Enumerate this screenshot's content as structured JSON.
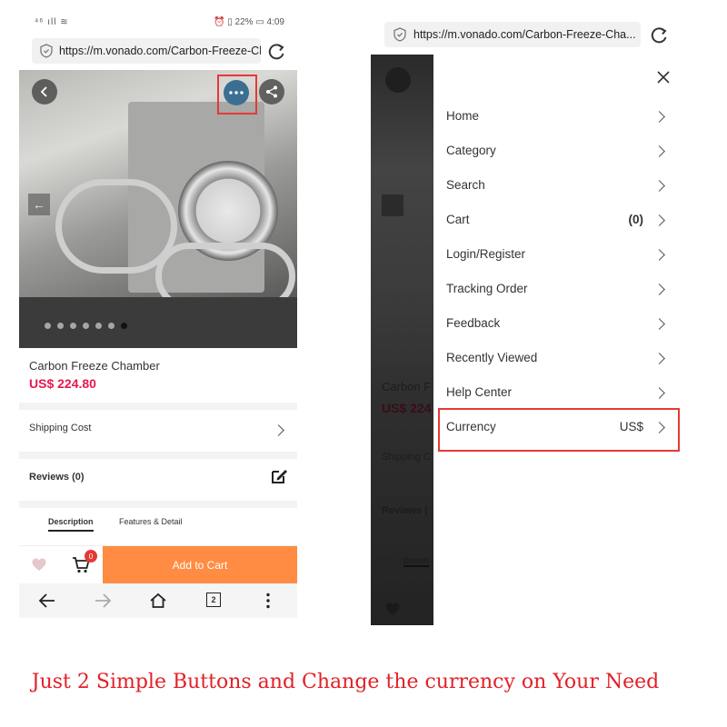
{
  "left_screen": {
    "status": {
      "left": "⁴⁶ ıll ≋",
      "right": "⏰ ▯ 22% ▭ 4:09"
    },
    "url": "https://m.vonado.com/Carbon-Freeze-Cha...",
    "product": {
      "title": "Carbon Freeze Chamber",
      "price": "US$ 224.80"
    },
    "rows": {
      "shipping": "Shipping Cost",
      "reviews": "Reviews (0)"
    },
    "tabs": [
      "Description",
      "Features & Detail"
    ],
    "cart": {
      "badge": "0",
      "add_to_cart": "Add to Cart"
    },
    "nav": {
      "tabs_count": "2"
    }
  },
  "right_screen": {
    "url": "https://m.vonado.com/Carbon-Freeze-Cha...",
    "ghost": {
      "title": "Carbon F",
      "price": "US$ 224",
      "shipping": "Shipping C",
      "reviews": "Reviews (",
      "desc": "Descri"
    },
    "menu": [
      {
        "label": "Home",
        "value": ""
      },
      {
        "label": "Category",
        "value": ""
      },
      {
        "label": "Search",
        "value": ""
      },
      {
        "label": "Cart",
        "value": "(0)"
      },
      {
        "label": "Login/Register",
        "value": ""
      },
      {
        "label": "Tracking Order",
        "value": ""
      },
      {
        "label": "Feedback",
        "value": ""
      },
      {
        "label": "Recently Viewed",
        "value": ""
      },
      {
        "label": "Help Center",
        "value": ""
      },
      {
        "label": "Currency",
        "value": "US$"
      }
    ]
  },
  "caption": "Just 2 Simple Buttons and Change the currency on Your Need",
  "colors": {
    "price": "#e8174e",
    "add_to_cart": "#ff8c42",
    "highlight": "#e53935",
    "caption": "#e32027"
  },
  "icons": [
    "shield-icon",
    "reload-icon",
    "back-icon",
    "more-icon",
    "share-icon",
    "arrow-left-icon",
    "chevron-right-icon",
    "edit-icon",
    "heart-icon",
    "cart-icon",
    "forward-icon",
    "home-icon",
    "tabs-icon",
    "menu-dots-icon",
    "close-icon"
  ]
}
